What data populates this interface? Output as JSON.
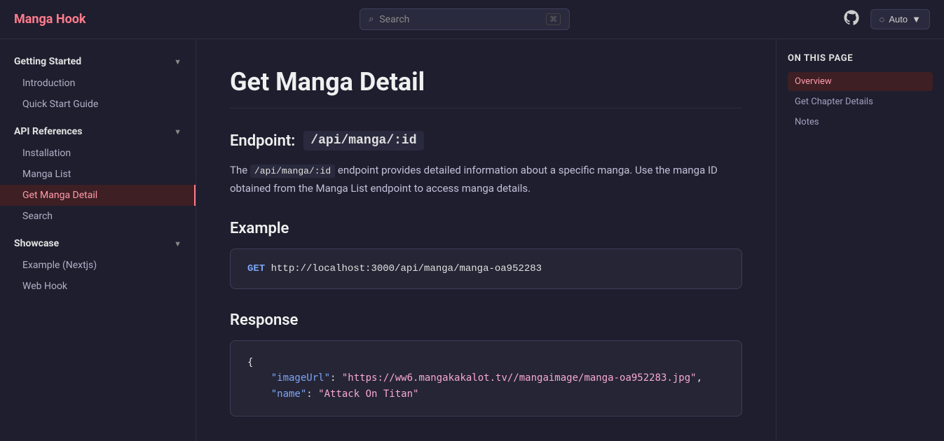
{
  "app": {
    "logo": "Manga Hook"
  },
  "topbar": {
    "search_placeholder": "Search",
    "theme_label": "Auto",
    "github_label": "GitHub"
  },
  "sidebar": {
    "sections": [
      {
        "label": "Getting Started",
        "expanded": true,
        "items": [
          {
            "label": "Introduction",
            "active": false
          },
          {
            "label": "Quick Start Guide",
            "active": false
          }
        ]
      },
      {
        "label": "API References",
        "expanded": true,
        "items": [
          {
            "label": "Installation",
            "active": false
          },
          {
            "label": "Manga List",
            "active": false
          },
          {
            "label": "Get Manga Detail",
            "active": true
          },
          {
            "label": "Search",
            "active": false
          }
        ]
      },
      {
        "label": "Showcase",
        "expanded": true,
        "items": [
          {
            "label": "Example (Nextjs)",
            "active": false
          },
          {
            "label": "Web Hook",
            "active": false
          }
        ]
      }
    ]
  },
  "main": {
    "page_title": "Get Manga Detail",
    "endpoint_label": "Endpoint:",
    "endpoint_code": "/api/manga/:id",
    "description_1": "The",
    "description_code": "/api/manga/:id",
    "description_2": "endpoint provides detailed information about a specific manga. Use the manga ID obtained from the Manga List endpoint to access manga details.",
    "example_title": "Example",
    "example_method": "GET",
    "example_url": "http://localhost:3000/api/manga/manga-oa952283",
    "response_title": "Response",
    "response_lines": [
      "{",
      "    \"imageUrl\": \"https://ww6.mangakakalot.tv//mangaimage/manga-oa952283.jpg\",",
      "    \"name\": \"Attack On Titan\""
    ]
  },
  "toc": {
    "title": "On this page",
    "items": [
      {
        "label": "Overview",
        "active": true
      },
      {
        "label": "Get Chapter Details",
        "active": false
      },
      {
        "label": "Notes",
        "active": false
      }
    ]
  }
}
